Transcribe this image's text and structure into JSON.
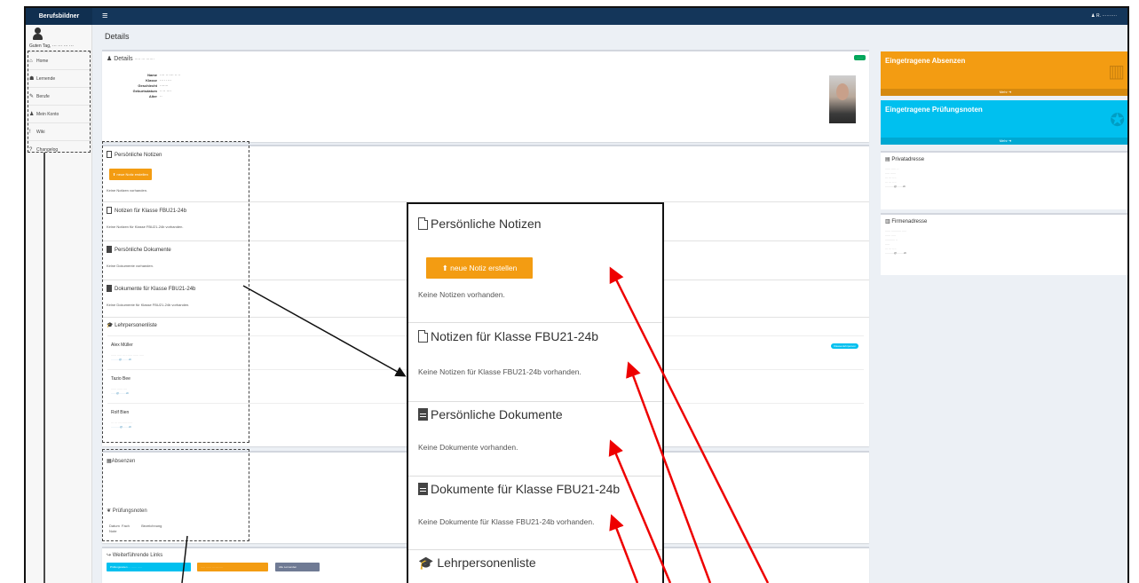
{
  "topbar": {
    "brand": "Berufsbildner",
    "menu_icon": "hamburger-icon",
    "user": "R. ··········"
  },
  "sidebar": {
    "greeting": "Guten Tag, ··· ··· ··· ···",
    "items": [
      {
        "icon": "home-icon",
        "glyph": "⌂",
        "label": "Home"
      },
      {
        "icon": "users-icon",
        "glyph": "☗",
        "label": "Lernende"
      },
      {
        "icon": "tools-icon",
        "glyph": "✎",
        "label": "Berufe"
      },
      {
        "icon": "user-icon",
        "glyph": "♟",
        "label": "Mein Konto"
      },
      {
        "icon": "exclamation-icon",
        "glyph": "!",
        "label": "Wiki"
      },
      {
        "icon": "help-icon",
        "glyph": "?",
        "label": "Changelog"
      }
    ]
  },
  "page": {
    "title": "Details"
  },
  "details": {
    "title": "Details",
    "subtitle": "····· ··· ·······",
    "badge": "·······",
    "rows": [
      {
        "k": "Name",
        "v": "···· ·· ···· ·· ··"
      },
      {
        "k": "Klasse",
        "v": "··· ·· ···"
      },
      {
        "k": "Geschlecht",
        "v": "·······"
      },
      {
        "k": "Geburtsdatum",
        "v": "·· ·· ····"
      },
      {
        "k": "Alter",
        "v": "··"
      }
    ]
  },
  "notes": {
    "personal_title": "Persönliche Notizen",
    "new_note_button": "neue Notiz erstellen",
    "no_notes": "Keine Notizen vorhanden.",
    "class_title": "Notizen für Klasse FBU21-24b",
    "class_none": "Keine Notizen für Klasse FBU21-24b vorhanden.",
    "docs_title": "Persönliche Dokumente",
    "docs_none": "Keine Dokumente vorhanden.",
    "class_docs_title": "Dokumente für Klasse FBU21-24b",
    "class_docs_none": "Keine Dokumente für Klasse FBU21-24b vorhanden."
  },
  "teachers": {
    "title": "Lehrpersonenliste",
    "badge": "Klassenlehrperson",
    "list": [
      {
        "name": "Alex Müller",
        "line1": "······ ····· ··· ·· ····· ······ ·····",
        "line2": "·········@·······.ch"
      },
      {
        "name": "Tazio Bee",
        "line1": "······ ······ ····",
        "line2": "······@·······.ch"
      },
      {
        "name": "Rolf Bien",
        "line1": "··· ··· ···· ······ ·····",
        "line2": "··········@······.ch"
      }
    ]
  },
  "absences": {
    "title": "Absenzen"
  },
  "grades": {
    "title": "Prüfungsnoten",
    "cols": [
      "Datum",
      "Fach",
      "Bezeichnung",
      "Note"
    ]
  },
  "links": {
    "title": "Weiterführende Links",
    "buttons": [
      {
        "label": "Prüfungsnoten ··· ······ ·····",
        "color": "#00c0ef"
      },
      {
        "label": "····· ······ ··· ···· ····",
        "color": "#f39c12"
      },
      {
        "label": "Alle Lernenden",
        "color": "#6f7a94"
      }
    ]
  },
  "info": {
    "absences": {
      "title": "Eingetragene Absenzen",
      "more": "Mehr",
      "color": "#f39c12"
    },
    "grades": {
      "title": "Eingetragene Prüfungsnoten",
      "more": "Mehr",
      "color": "#00c0ef"
    }
  },
  "private_address": {
    "title": "Privatadresse",
    "lines": [
      "······ ····· · ·",
      "····· ······",
      "··· ··· ·· ··",
      "··· ··· ·· ··",
      "··········@······.ch"
    ]
  },
  "company_address": {
    "title": "Firmenadresse",
    "lines": [
      "······ ··········· ·····",
      "······ ·····",
      "··········· ··",
      "·····",
      "··· ··· ·· ··",
      "··········@·······.ch"
    ]
  },
  "colors": {
    "topbar": "#14365a",
    "accent_orange": "#f39c12",
    "accent_cyan": "#00c0ef",
    "annotation": "#ee0000"
  }
}
